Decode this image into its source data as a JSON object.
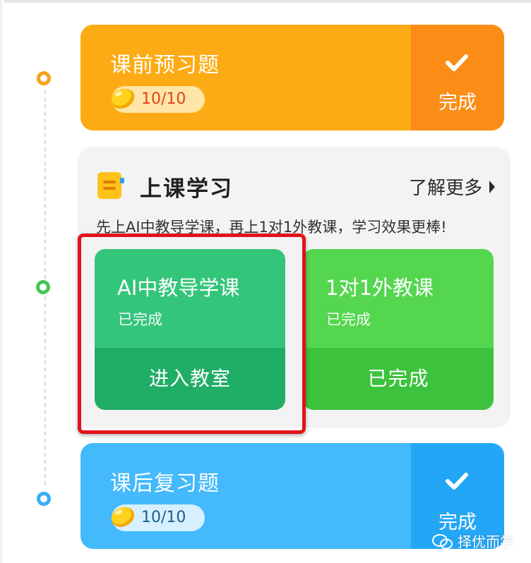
{
  "pre_class": {
    "title": "课前预习题",
    "score": "10/10",
    "status_label": "完成",
    "icon": "bean-icon",
    "colors": {
      "card": "#fdab14",
      "done": "#fb8d17"
    }
  },
  "lesson": {
    "title": "上课学习",
    "more_label": "了解更多",
    "description": "先上AI中教导学课，再上1对1外教课，学习效果更棒!",
    "courses": [
      {
        "name": "AI中教导学课",
        "status": "已完成",
        "action_label": "进入教室",
        "color": "#33c57a"
      },
      {
        "name": "1对1外教课",
        "status": "已完成",
        "action_label": "已完成",
        "color": "#55d64f"
      }
    ],
    "highlight_color": "#e3121b"
  },
  "post_class": {
    "title": "课后复习题",
    "score": "10/10",
    "status_label": "完成",
    "colors": {
      "card": "#44b9fb",
      "done": "#24a6f7"
    }
  },
  "watermark": {
    "text": "择优而学",
    "icon": "wechat-icon"
  }
}
